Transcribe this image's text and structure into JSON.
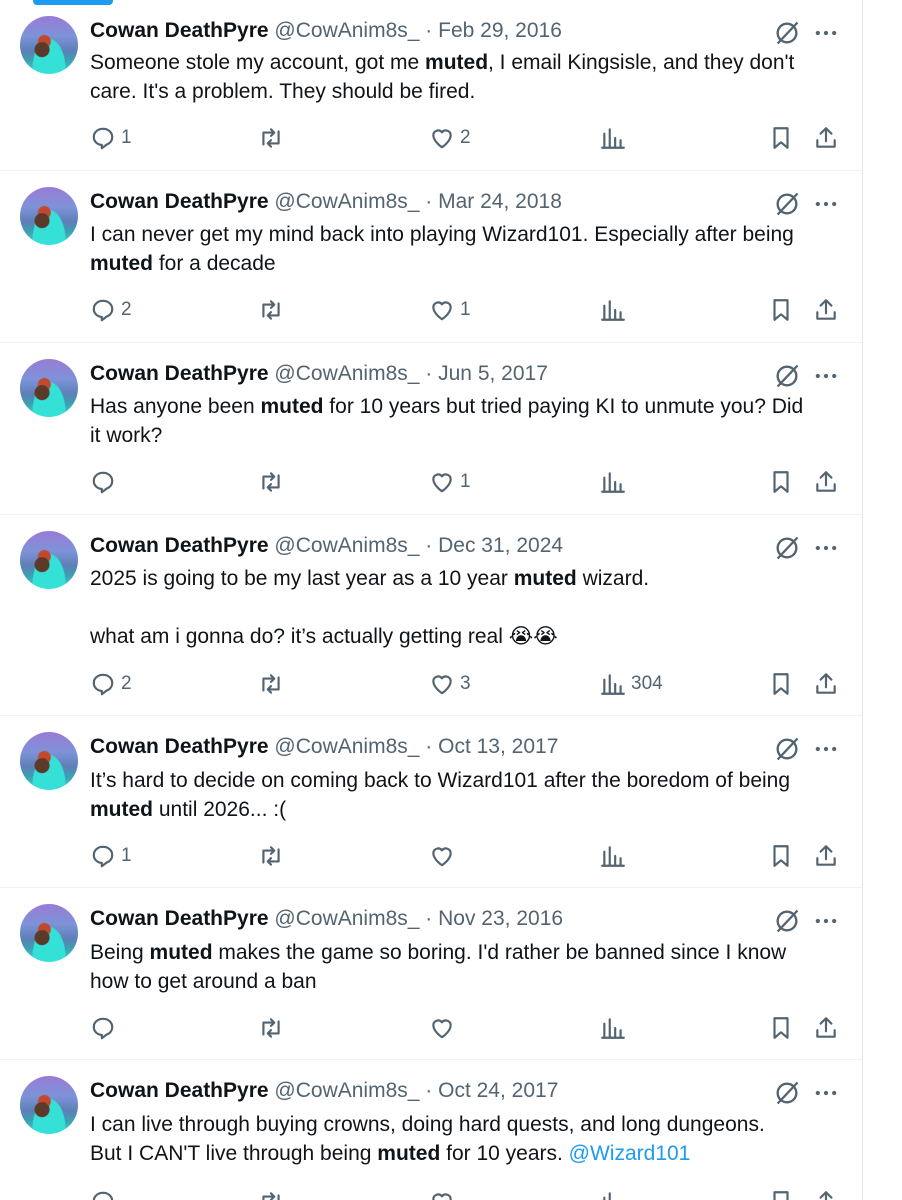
{
  "tweets": [
    {
      "name": "Cowan DeathPyre",
      "handle": "@CowAnim8s_",
      "date": "Feb 29, 2016",
      "line1": [
        "Someone stole my account, got me ",
        "muted",
        ", I email Kingsisle, and they don't"
      ],
      "line2": "care. It's a problem. They should be fired.",
      "replies": "1",
      "reposts": "",
      "likes": "2",
      "views": ""
    },
    {
      "name": "Cowan DeathPyre",
      "handle": "@CowAnim8s_",
      "date": "Mar 24, 2018",
      "line1": "I can never get my mind back into playing Wizard101. Especially after being",
      "line2": [
        "muted",
        " for a decade"
      ],
      "replies": "2",
      "reposts": "",
      "likes": "1",
      "views": ""
    },
    {
      "name": "Cowan DeathPyre",
      "handle": "@CowAnim8s_",
      "date": "Jun 5, 2017",
      "line1": [
        "Has anyone been ",
        "muted",
        " for 10 years but tried paying KI to unmute you? Did"
      ],
      "line2": "it work?",
      "replies": "",
      "reposts": "",
      "likes": "1",
      "views": ""
    },
    {
      "name": "Cowan DeathPyre",
      "handle": "@CowAnim8s_",
      "date": "Dec 31, 2024",
      "line1": [
        "2025 is going to be my last year as a 10 year ",
        "muted",
        " wizard."
      ],
      "line2": "what am i gonna do? it’s actually getting real 😭😭",
      "replies": "2",
      "reposts": "",
      "likes": "3",
      "views": "304"
    },
    {
      "name": "Cowan DeathPyre",
      "handle": "@CowAnim8s_",
      "date": "Oct 13, 2017",
      "line1": "It’s hard to decide on coming back to Wizard101 after the boredom of being",
      "line2": [
        "muted",
        " until 2026... :("
      ],
      "replies": "1",
      "reposts": "",
      "likes": "",
      "views": ""
    },
    {
      "name": "Cowan DeathPyre",
      "handle": "@CowAnim8s_",
      "date": "Nov 23, 2016",
      "line1": [
        "Being ",
        "muted",
        " makes the game so boring. I'd rather be banned since I know"
      ],
      "line2": "how to get around a ban",
      "replies": "",
      "reposts": "",
      "likes": "",
      "views": ""
    },
    {
      "name": "Cowan DeathPyre",
      "handle": "@CowAnim8s_",
      "date": "Oct 24, 2017",
      "line1": "I can live through buying crowns, doing hard quests, and long dungeons.",
      "line2": [
        "But I CAN'T live through being ",
        "muted",
        " for 10 years. "
      ],
      "mention": "@Wizard101",
      "replies": "",
      "reposts": "",
      "likes": "",
      "views": ""
    }
  ],
  "separator": "·",
  "icons": {
    "grok": "grok-icon",
    "more": "more-icon",
    "reply": "reply-icon",
    "repost": "repost-icon",
    "like": "like-icon",
    "views": "views-icon",
    "bookmark": "bookmark-icon",
    "share": "share-icon"
  },
  "colors": {
    "mention": "#1d9bf0",
    "secondary_text": "#536471",
    "icon": "#536471",
    "divider": "#eff3f4"
  }
}
